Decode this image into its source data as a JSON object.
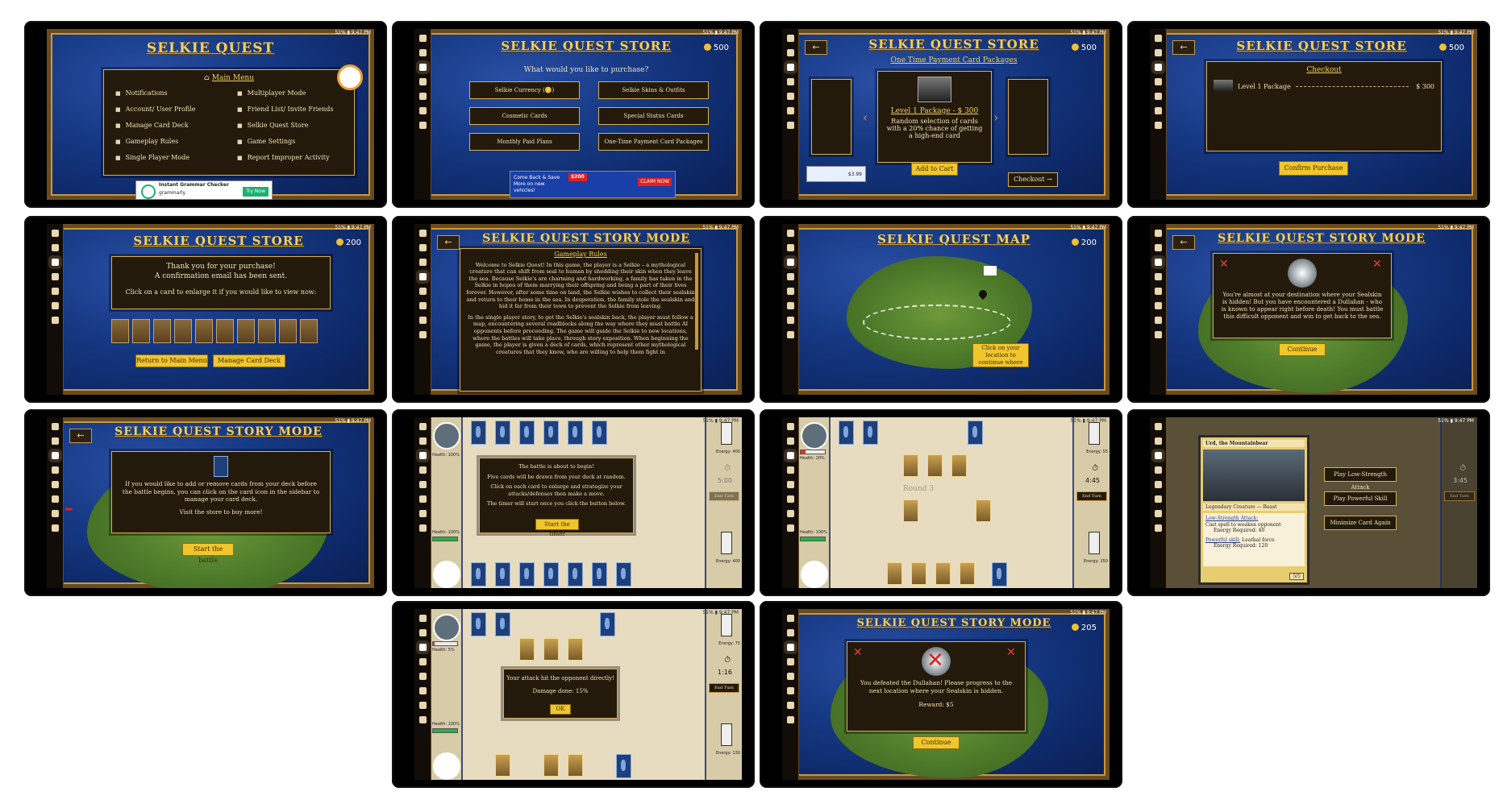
{
  "status_bar": {
    "text": "51% ▮ 9:47 PM"
  },
  "screens": {
    "main_menu": {
      "title": "SELKIE QUEST",
      "heading": "Main Menu",
      "left": [
        "Notifications",
        "Account/ User Profile",
        "Manage Card Deck",
        "Gameplay Rules",
        "Single Player Mode"
      ],
      "right": [
        "Multiplayer Mode",
        "Friend List/ Invite Friends",
        "Selkie Quest Store",
        "Game Settings",
        "Report Improper Activity"
      ],
      "ad_title": "Instant Grammar Checker",
      "ad_sub": "grammarly",
      "ad_btn": "Try Now"
    },
    "store": {
      "title": "SELKIE QUEST STORE",
      "coins": "500",
      "question": "What would you like to purchase?",
      "options": [
        "Selkie Currency (🪙)",
        "Selkie Skins & Outfits",
        "Cosmetic Cards",
        "Special Status Cards",
        "Monthly Paid Plans",
        "One-Time Payment Card Packages"
      ],
      "ad_line1": "Come Back & Save More on new vehicles!",
      "ad_badge": "$200",
      "ad_badge_sub": "BONUS DISCOUNT",
      "ad_btn": "CLAIM NOW"
    },
    "packages": {
      "title": "SELKIE QUEST STORE",
      "coins": "500",
      "subtitle": "One Time Payment Card Packages",
      "pkg_name": "Level 1 Package - $ 300",
      "pkg_desc": "Random selection of cards with a 20% chance of getting a high-end card",
      "add_btn": "Add to Cart",
      "checkout_btn": "Checkout →",
      "ad_price": "$3.99"
    },
    "checkout": {
      "title": "SELKIE QUEST STORE",
      "coins": "500",
      "heading": "Checkout",
      "item": "Level 1 Package",
      "price": "$ 300",
      "confirm": "Confirm Purchase"
    },
    "thanks": {
      "title": "SELKIE QUEST STORE",
      "coins": "200",
      "line1": "Thank you for your purchase!",
      "line2": "A confirmation email has been sent.",
      "line3": "Click on a card to enlarge it if you would like to view now:",
      "btn1": "Return to Main Menu",
      "btn2": "Manage Card Deck"
    },
    "rules": {
      "title": "SELKIE QUEST STORY MODE",
      "heading": "Gameplay Rules",
      "p1": "Welcome to Selkie Quest! In this game, the player is a Selkie – a mythological creature that can shift from seal to human by shedding their skin when they leave the sea. Because Selkie's are charming and hardworking, a family has taken in the Selkie in hopes of them marrying their offspring and being a part of their lives forever. However, after some time on land, the Selkie wishes to collect their sealskin and return to their home in the sea. In desperation, the family stole the sealskin and hid it far from their town to prevent the Selkie from leaving.",
      "p2": "In the single player story, to get the Selkie's sealskin back, the player must follow a map, encountering several roadblocks along the way where they must battle AI opponents before proceeding. The game will guide the Selkie to new locations, where the battles will take place, through story exposition. When beginning the game, the player is given a deck of cards, which represent other mythological creatures that they know, who are willing to help them fight in"
    },
    "map": {
      "title": "SELKIE QUEST MAP",
      "coins": "200",
      "hint": "Click on your location to continue where you left off"
    },
    "story1": {
      "title": "SELKIE QUEST STORY MODE",
      "text": "You're almost at your destination where your Sealskin is hidden! But you have encountered a Dullahan - who is known to appear right before death! You must battle this difficult opponent and win to get back to the sea.",
      "btn": "Continue"
    },
    "story2": {
      "title": "SELKIE QUEST STORY MODE",
      "text": "If you would like to add or remove cards from your deck before the battle begins, you can click on the card icon in the sidebar to manage your card deck.",
      "text2": "Visit the store to buy more!",
      "btn": "Start the battle"
    },
    "battle1": {
      "health_top": "Health: 100%",
      "health_bottom": "Health: 100%",
      "energy_top": "Energy: 400",
      "energy_bottom": "Energy: 400",
      "timer": "5:00",
      "end_turn": "End Turn",
      "msg1": "The battle is about to begin!",
      "msg2": "Five cards will be drawn from your deck at random.",
      "msg3": "Click on each card to enlarge and strategize your attacks/defenses then make a move.",
      "msg4": "The timer will start once you click the button below.",
      "btn": "Start the timer"
    },
    "battle2": {
      "health_top": "Health: 20%",
      "health_bottom": "Health: 100%",
      "energy_top": "Energy: 55",
      "energy_bottom": "Energy: 250",
      "timer": "4:45",
      "end_turn": "End Turn",
      "round": "Round 3"
    },
    "battle3": {
      "card_name": "Urd, the Mountainbear",
      "type_line": "Legendary Creature — Beast",
      "low_label": "Low-Strength Attack:",
      "low_desc": "Cast spell to weaken opponent",
      "low_energy": "Energy Required: 40",
      "pow_label": "Powerful skill:",
      "pow_desc": "Leathal force",
      "pow_energy": "Energy Required: 120",
      "pt": "5/5",
      "btn1": "Play Low-Strength Attack",
      "btn2": "Play Powerful Skill",
      "btn3": "Minimize Card Again",
      "timer": "3:45",
      "end_turn": "End Turn"
    },
    "battle4": {
      "health_top": "Health: 5%",
      "health_bottom": "Health: 100%",
      "energy_top": "Energy: 75",
      "energy_bottom": "Energy: 130",
      "timer": "1:16",
      "end_turn": "End Turn",
      "msg": "Your attack hit the opponent directly!",
      "dmg": "Damage done: 15%",
      "ok": "OK"
    },
    "victory": {
      "title": "SELKIE QUEST STORY MODE",
      "coins": "205",
      "text": "You defeated the Dullahan! Please progress to the next location where your Sealskin is hidden.",
      "reward": "Reward: $5",
      "btn": "Continue"
    }
  }
}
